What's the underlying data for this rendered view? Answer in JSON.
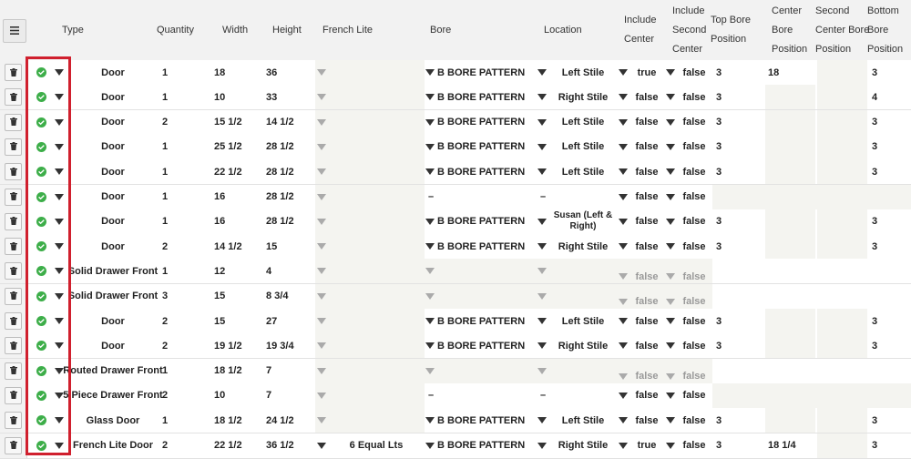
{
  "header": {
    "menu_icon": "hamburger-menu-icon",
    "columns": {
      "type": "Type",
      "quantity": "Quantity",
      "width": "Width",
      "height": "Height",
      "french_lite": "French Lite",
      "bore": "Bore",
      "location": "Location",
      "include_center": "Include\nCenter",
      "include_second_center": "Include\nSecond\nCenter",
      "top_bore_position": "Top Bore\nPosition",
      "center_bore_position": "Center\nBore\nPosition",
      "second_center_bore_position": "Second\nCenter Bore\nPosition",
      "bottom_bore_position": "Bottom\nBore\nPosition"
    }
  },
  "rows": [
    {
      "type": "Door",
      "quantity": "1",
      "width": "18",
      "height": "36",
      "french_lite": "",
      "bore": "B BORE PATTERN",
      "location": "Left Stile",
      "include_center": "true",
      "include_second_center": "false",
      "top": "3",
      "center": "18",
      "second_center": "",
      "bottom": "3"
    },
    {
      "type": "Door",
      "quantity": "1",
      "width": "10",
      "height": "33",
      "french_lite": "",
      "bore": "B BORE PATTERN",
      "location": "Right Stile",
      "include_center": "false",
      "include_second_center": "false",
      "top": "3",
      "center": "",
      "second_center": "",
      "bottom": "4"
    },
    {
      "type": "Door",
      "quantity": "2",
      "width": "15 1/2",
      "height": "14 1/2",
      "french_lite": "",
      "bore": "B BORE PATTERN",
      "location": "Left Stile",
      "include_center": "false",
      "include_second_center": "false",
      "top": "3",
      "center": "",
      "second_center": "",
      "bottom": "3"
    },
    {
      "type": "Door",
      "quantity": "1",
      "width": "25 1/2",
      "height": "28 1/2",
      "french_lite": "",
      "bore": "B BORE PATTERN",
      "location": "Left Stile",
      "include_center": "false",
      "include_second_center": "false",
      "top": "3",
      "center": "",
      "second_center": "",
      "bottom": "3"
    },
    {
      "type": "Door",
      "quantity": "1",
      "width": "22 1/2",
      "height": "28 1/2",
      "french_lite": "",
      "bore": "B BORE PATTERN",
      "location": "Left Stile",
      "include_center": "false",
      "include_second_center": "false",
      "top": "3",
      "center": "",
      "second_center": "",
      "bottom": "3"
    },
    {
      "type": "Door",
      "quantity": "1",
      "width": "16",
      "height": "28 1/2",
      "french_lite": "",
      "bore": "–",
      "location": "–",
      "include_center": "false",
      "include_second_center": "false",
      "top": "",
      "center": "",
      "second_center": "",
      "bottom": ""
    },
    {
      "type": "Door",
      "quantity": "1",
      "width": "16",
      "height": "28 1/2",
      "french_lite": "",
      "bore": "B BORE PATTERN",
      "location": "Susan (Left & Right)",
      "include_center": "false",
      "include_second_center": "false",
      "top": "3",
      "center": "",
      "second_center": "",
      "bottom": "3"
    },
    {
      "type": "Door",
      "quantity": "2",
      "width": "14 1/2",
      "height": "15",
      "french_lite": "",
      "bore": "B BORE PATTERN",
      "location": "Right Stile",
      "include_center": "false",
      "include_second_center": "false",
      "top": "3",
      "center": "",
      "second_center": "",
      "bottom": "3"
    },
    {
      "type": "Solid Drawer Front",
      "quantity": "1",
      "width": "12",
      "height": "4",
      "french_lite": "",
      "bore": "",
      "location": "",
      "include_center": "false",
      "include_second_center": "false",
      "top": "",
      "center": "",
      "second_center": "",
      "bottom": ""
    },
    {
      "type": "Solid Drawer Front",
      "quantity": "3",
      "width": "15",
      "height": "8 3/4",
      "french_lite": "",
      "bore": "",
      "location": "",
      "include_center": "false",
      "include_second_center": "false",
      "top": "",
      "center": "",
      "second_center": "",
      "bottom": ""
    },
    {
      "type": "Door",
      "quantity": "2",
      "width": "15",
      "height": "27",
      "french_lite": "",
      "bore": "B BORE PATTERN",
      "location": "Left Stile",
      "include_center": "false",
      "include_second_center": "false",
      "top": "3",
      "center": "",
      "second_center": "",
      "bottom": "3"
    },
    {
      "type": "Door",
      "quantity": "2",
      "width": "19 1/2",
      "height": "19 3/4",
      "french_lite": "",
      "bore": "B BORE PATTERN",
      "location": "Right Stile",
      "include_center": "false",
      "include_second_center": "false",
      "top": "3",
      "center": "",
      "second_center": "",
      "bottom": "3"
    },
    {
      "type": "Routed Drawer Front",
      "quantity": "1",
      "width": "18 1/2",
      "height": "7",
      "french_lite": "",
      "bore": "",
      "location": "",
      "include_center": "false",
      "include_second_center": "false",
      "top": "",
      "center": "",
      "second_center": "",
      "bottom": ""
    },
    {
      "type": "5 Piece Drawer Front",
      "quantity": "2",
      "width": "10",
      "height": "7",
      "french_lite": "",
      "bore": "–",
      "location": "–",
      "include_center": "false",
      "include_second_center": "false",
      "top": "",
      "center": "",
      "second_center": "",
      "bottom": ""
    },
    {
      "type": "Glass Door",
      "quantity": "1",
      "width": "18 1/2",
      "height": "24 1/2",
      "french_lite": "",
      "bore": "B BORE PATTERN",
      "location": "Left Stile",
      "include_center": "false",
      "include_second_center": "false",
      "top": "3",
      "center": "",
      "second_center": "",
      "bottom": "3"
    },
    {
      "type": "French Lite Door",
      "quantity": "2",
      "width": "22 1/2",
      "height": "36 1/2",
      "french_lite": "6 Equal Lts",
      "bore": "B BORE PATTERN",
      "location": "Right Stile",
      "include_center": "true",
      "include_second_center": "false",
      "top": "3",
      "center": "18 1/4",
      "second_center": "",
      "bottom": "3"
    }
  ],
  "colors": {
    "check": "#3dae49",
    "highlight": "#d0202e",
    "header_bg": "#f2f2f2"
  }
}
